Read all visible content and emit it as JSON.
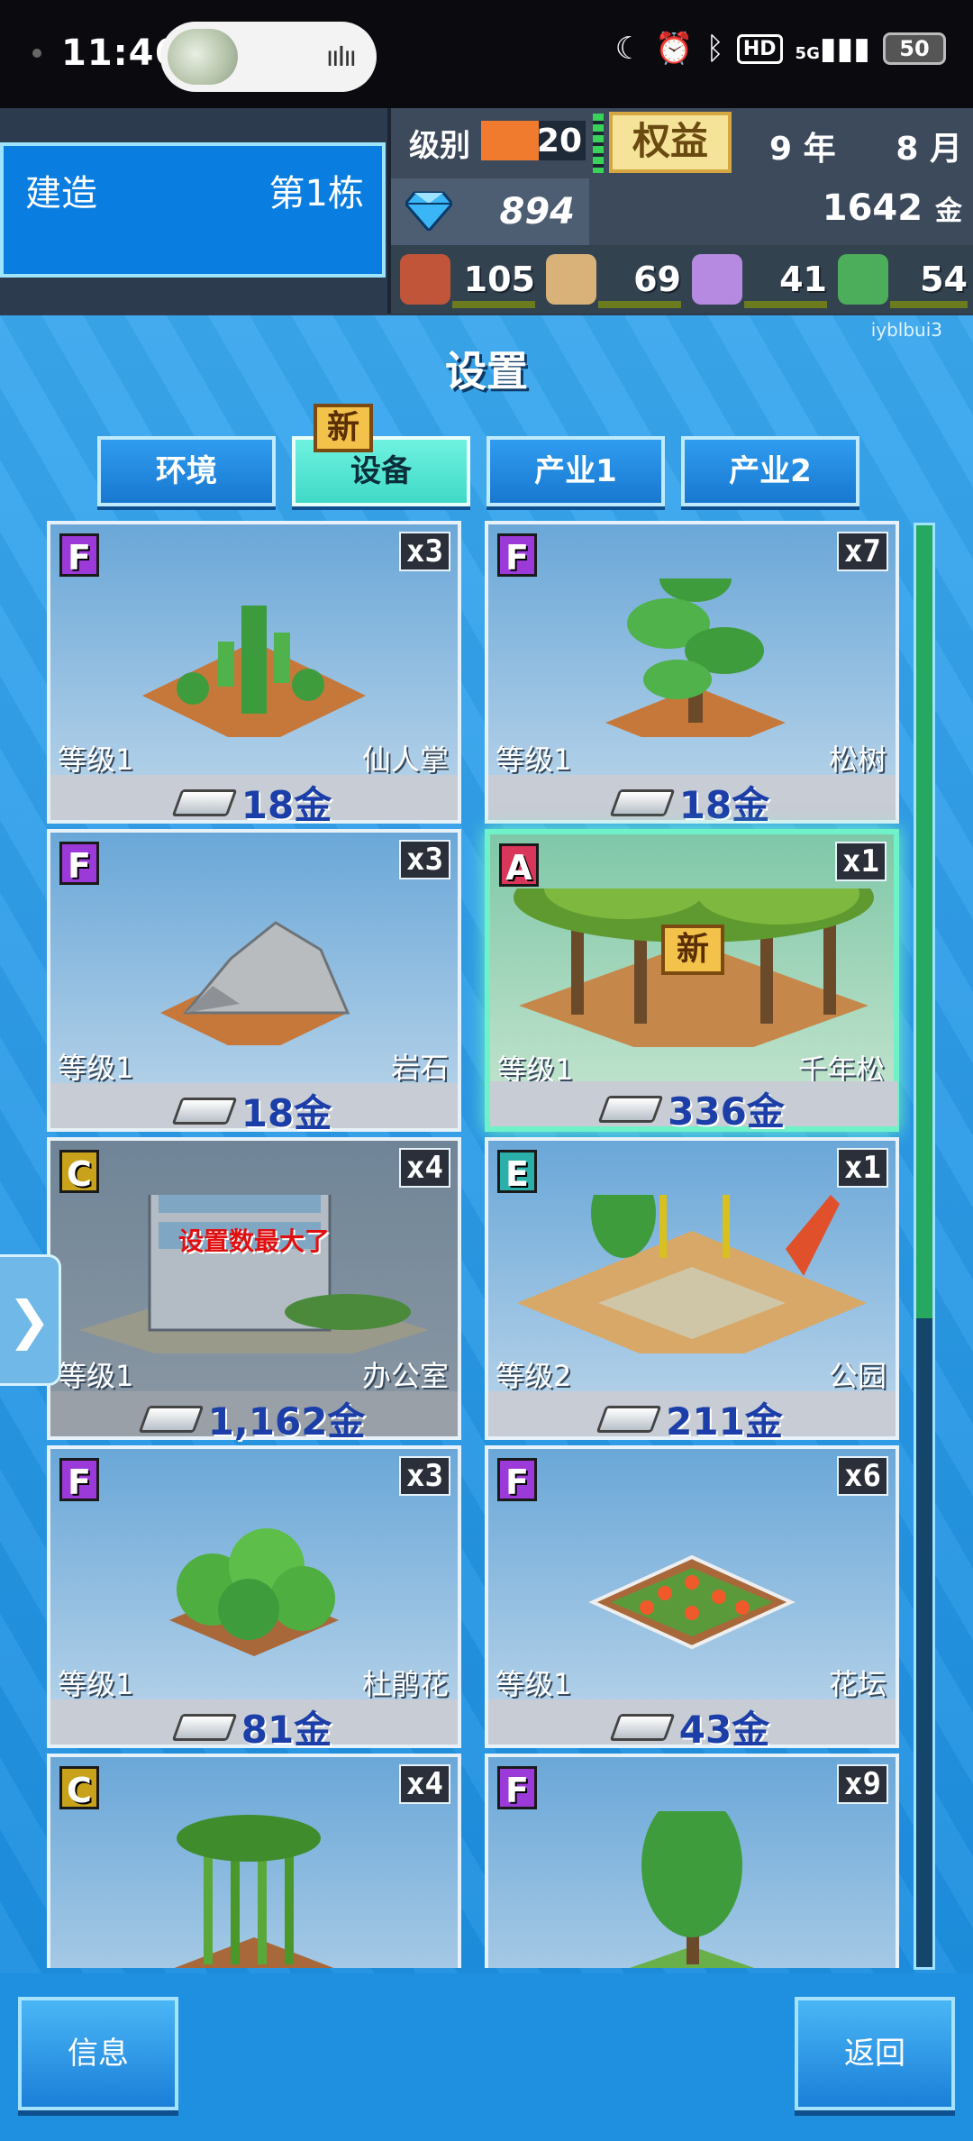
{
  "status_bar": {
    "time": "11:46",
    "hd_label": "HD",
    "signal_label": "5G",
    "battery": "50"
  },
  "hud": {
    "build_label": "建造",
    "building": "第1栋",
    "level_label": "级别",
    "level_value": "20",
    "rights_label": "权益",
    "year": "9 年",
    "month": "8 月",
    "gems": "894",
    "gold": "1642",
    "gold_unit": "金",
    "resources": [
      {
        "icon": "food-icon",
        "value": "105",
        "color": "#c0553a"
      },
      {
        "icon": "bag-icon",
        "value": "69",
        "color": "#d9b27a"
      },
      {
        "icon": "music-note-icon",
        "value": "41",
        "color": "#b58ae0"
      },
      {
        "icon": "book-icon",
        "value": "54",
        "color": "#4cae5a"
      }
    ]
  },
  "watermark": "iyblbui3",
  "dialog": {
    "title": "设置",
    "tabs": [
      {
        "label": "环境",
        "active": false
      },
      {
        "label": "设备",
        "active": true
      },
      {
        "label": "产业1",
        "active": false
      },
      {
        "label": "产业2",
        "active": false
      }
    ],
    "new_badge": "新"
  },
  "items": [
    {
      "rank": "F",
      "rank_color": "#9b3ad8",
      "count": "x3",
      "level": "等级1",
      "name": "仙人掌",
      "price": "18金",
      "art": "cactus"
    },
    {
      "rank": "F",
      "rank_color": "#9b3ad8",
      "count": "x7",
      "level": "等级1",
      "name": "松树",
      "price": "18金",
      "art": "pine"
    },
    {
      "rank": "F",
      "rank_color": "#9b3ad8",
      "count": "x3",
      "level": "等级1",
      "name": "岩石",
      "price": "18金",
      "art": "rock"
    },
    {
      "rank": "A",
      "rank_color": "#d8365a",
      "count": "x1",
      "level": "等级1",
      "name": "千年松",
      "price": "336金",
      "art": "bigtree",
      "new": "新"
    },
    {
      "rank": "C",
      "rank_color": "#c8a21a",
      "count": "x4",
      "level": "等级1",
      "name": "办公室",
      "price": "1,162金",
      "art": "office",
      "status": "设置数最大了"
    },
    {
      "rank": "E",
      "rank_color": "#2ab0a8",
      "count": "x1",
      "level": "等级2",
      "name": "公园",
      "price": "211金",
      "art": "park"
    },
    {
      "rank": "F",
      "rank_color": "#9b3ad8",
      "count": "x3",
      "level": "等级1",
      "name": "杜鹃花",
      "price": "81金",
      "art": "azalea"
    },
    {
      "rank": "F",
      "rank_color": "#9b3ad8",
      "count": "x6",
      "level": "等级1",
      "name": "花坛",
      "price": "43金",
      "art": "flowerbed"
    },
    {
      "rank": "C",
      "rank_color": "#c8a21a",
      "count": "x4",
      "art": "bamboo"
    },
    {
      "rank": "F",
      "rank_color": "#9b3ad8",
      "count": "x9",
      "art": "tree"
    }
  ],
  "buttons": {
    "info": "信息",
    "back": "返回"
  }
}
